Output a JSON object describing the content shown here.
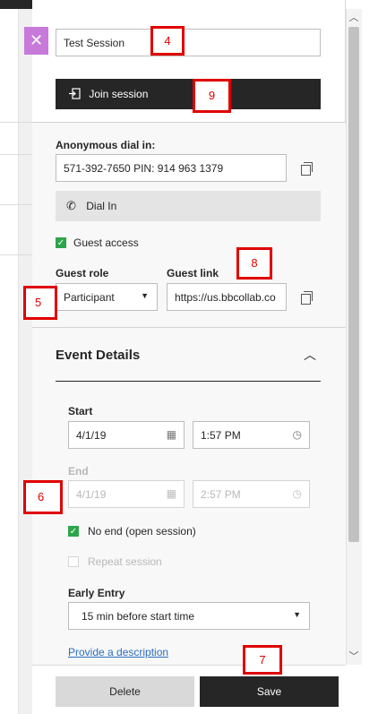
{
  "panel": {
    "close_glyph": "✕",
    "session_name": "Test Session",
    "join_label": "Join session",
    "join_icon": "enter-icon"
  },
  "dial_in": {
    "label": "Anonymous dial in:",
    "value": "571-392-7650 PIN: 914 963 1379",
    "button_label": "Dial In",
    "button_icon": "phone-icon"
  },
  "guest": {
    "access_label": "Guest access",
    "access_checked": true,
    "role_label": "Guest role",
    "role_value": "Participant",
    "link_label": "Guest link",
    "link_value": "https://us.bbcollab.co"
  },
  "event_details": {
    "title": "Event Details",
    "start_label": "Start",
    "start_date": "4/1/19",
    "start_time": "1:57 PM",
    "end_label": "End",
    "end_date": "4/1/19",
    "end_time": "2:57 PM",
    "no_end_label": "No end (open session)",
    "no_end_checked": true,
    "repeat_label": "Repeat session",
    "repeat_checked": false,
    "early_entry_label": "Early Entry",
    "early_entry_value": "15 min before start time",
    "description_link": "Provide a description"
  },
  "footer": {
    "delete_label": "Delete",
    "save_label": "Save"
  },
  "markers": [
    "4",
    "9",
    "8",
    "5",
    "6",
    "7"
  ],
  "colors": {
    "accent_purple": "#c77ad9",
    "dark_button": "#262626",
    "check_green": "#2da54a",
    "marker_red": "#e00000",
    "link_blue": "#2a6ebd"
  }
}
